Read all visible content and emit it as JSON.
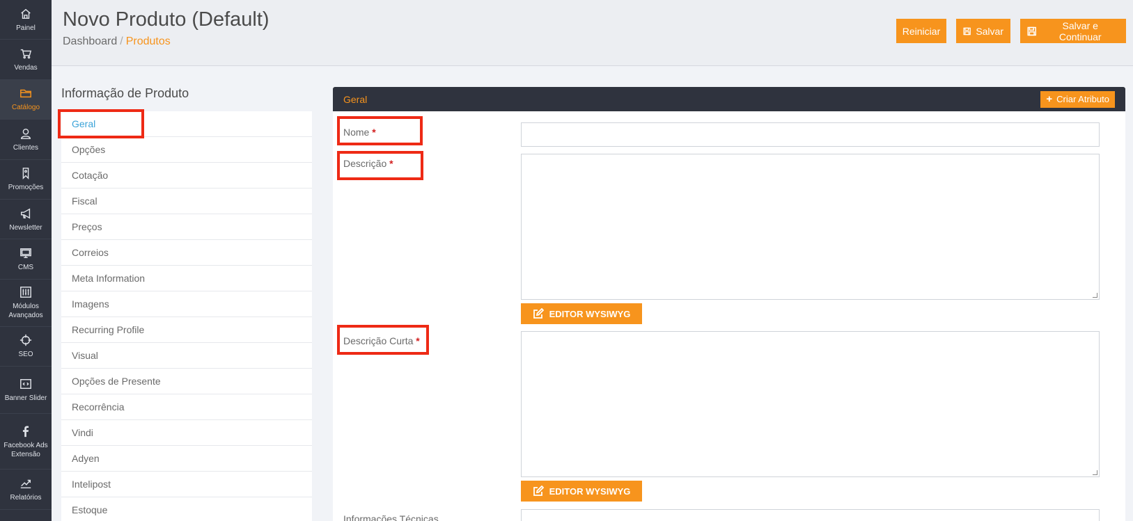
{
  "sidebar": {
    "items": [
      {
        "label": "Painel",
        "icon": "home-icon"
      },
      {
        "label": "Vendas",
        "icon": "cart-icon"
      },
      {
        "label": "Catálogo",
        "icon": "folder-icon"
      },
      {
        "label": "Clientes",
        "icon": "user-icon"
      },
      {
        "label": "Promoções",
        "icon": "tag-icon"
      },
      {
        "label": "Newsletter",
        "icon": "megaphone-icon"
      },
      {
        "label": "CMS",
        "icon": "monitor-icon"
      },
      {
        "label": "Módulos Avançados",
        "icon": "sliders-icon"
      },
      {
        "label": "SEO",
        "icon": "crosshair-icon"
      },
      {
        "label": "Banner Slider",
        "icon": "code-icon"
      },
      {
        "label": "Facebook Ads Extensão",
        "icon": "facebook-icon"
      },
      {
        "label": "Relatórios",
        "icon": "chart-icon"
      }
    ],
    "active_index": 2
  },
  "header": {
    "title": "Novo Produto (Default)",
    "breadcrumb": {
      "root": "Dashboard",
      "separator": "/",
      "current": "Produtos"
    },
    "buttons": {
      "reset": "Reiniciar",
      "save": "Salvar",
      "save_continue": "Salvar e Continuar"
    }
  },
  "product_info": {
    "title": "Informação de Produto",
    "tabs": [
      "Geral",
      "Opções",
      "Cotação",
      "Fiscal",
      "Preços",
      "Correios",
      "Meta Information",
      "Imagens",
      "Recurring Profile",
      "Visual",
      "Opções de Presente",
      "Recorrência",
      "Vindi",
      "Adyen",
      "Intelipost",
      "Estoque"
    ],
    "active_tab": "Geral"
  },
  "panel": {
    "title": "Geral",
    "create_attribute": "Criar Atributo",
    "fields": {
      "name_label": "Nome",
      "description_label": "Descrição",
      "short_description_label": "Descrição Curta",
      "technical_label": "Informações Técnicas",
      "required_mark": "*",
      "editor_button": "EDITOR WYSIWYG"
    }
  },
  "colors": {
    "accent": "#f7941d",
    "sidebar_bg": "#2f333e",
    "highlight": "#ee2a15",
    "active_tab": "#3aa3d8"
  }
}
